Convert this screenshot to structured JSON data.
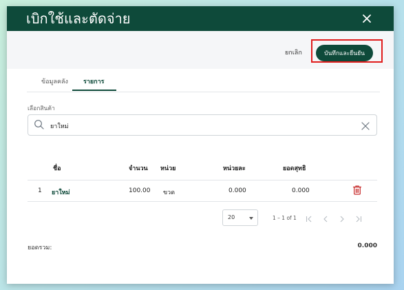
{
  "header": {
    "title": "เบิกใช้และตัดจ่าย"
  },
  "toolbar": {
    "cancel_label": "ยกเลิก",
    "save_label": "บันทึกและยืนยัน"
  },
  "tabs": [
    {
      "label": "ข้อมูลคลัง",
      "active": false
    },
    {
      "label": "รายการ",
      "active": true
    }
  ],
  "product_select": {
    "label": "เลือกสินค้า",
    "value": "ยาใหม่"
  },
  "table": {
    "columns": [
      "ชื่อ",
      "จำนวน",
      "หน่วย",
      "หน่วยละ",
      "ยอดสุทธิ"
    ],
    "rows": [
      {
        "index": "1",
        "name": "ยาใหม่",
        "quantity": "100.00",
        "unit": "ขวด",
        "unit_price": "0.000",
        "net": "0.000"
      }
    ]
  },
  "pagination": {
    "rows_per_page": "20",
    "range": "1 – 1 of 1"
  },
  "summary": {
    "total_label": "ยอดรวม:",
    "total_value": "0.000"
  },
  "colors": {
    "primary": "#0e4a3a",
    "highlight": "#e01b1b",
    "delete": "#c62828"
  },
  "icons": [
    "close-icon",
    "search-icon",
    "clear-icon",
    "trash-icon",
    "first-page-icon",
    "prev-page-icon",
    "next-page-icon",
    "last-page-icon",
    "dropdown-caret-icon"
  ]
}
